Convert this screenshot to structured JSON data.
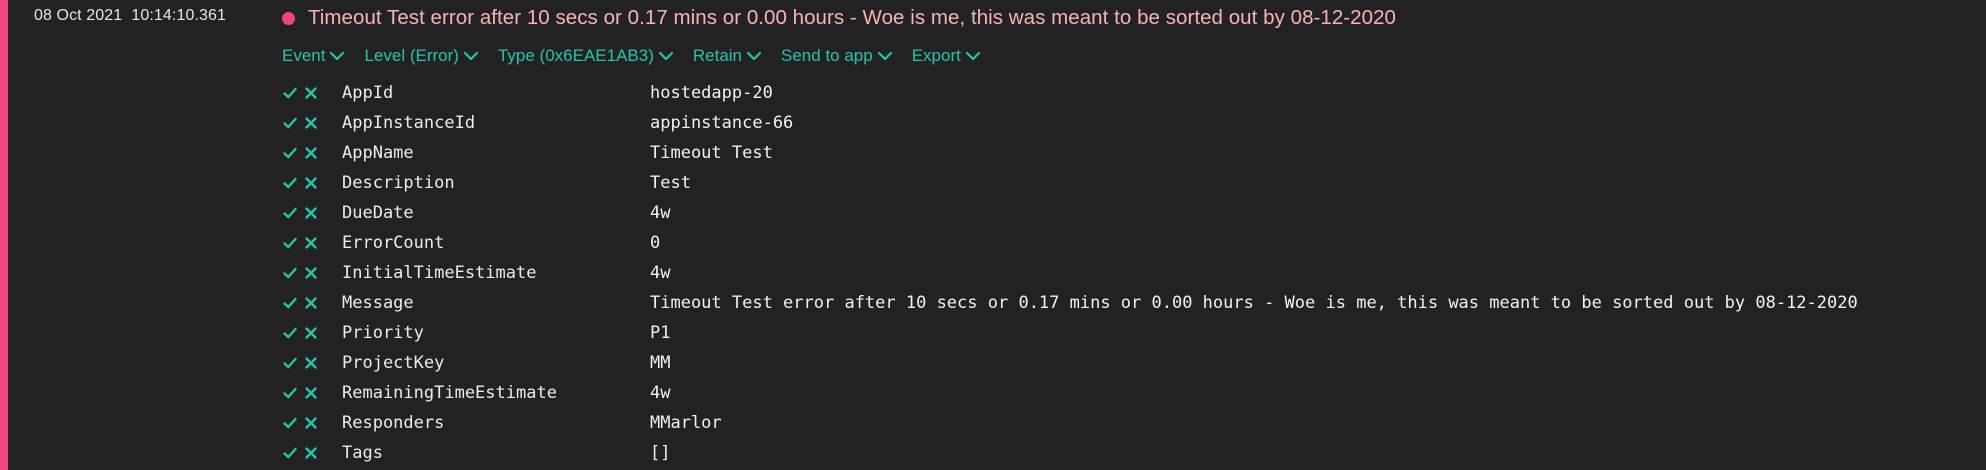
{
  "event": {
    "timestamp": "08 Oct 2021  10:14:10.361",
    "level_color": "#f0457a",
    "title_color": "#f8b4ae",
    "message": "Timeout Test error after 10 secs or 0.17 mins or 0.00 hours - Woe is me, this was meant to be sorted out by 08-12-2020"
  },
  "toolbar": {
    "accent_color": "#27c5a6",
    "items": [
      {
        "label": "Event",
        "icon": "chevron-down-icon"
      },
      {
        "label": "Level (Error)",
        "icon": "chevron-down-icon"
      },
      {
        "label": "Type (0x6EAE1AB3)",
        "icon": "chevron-down-icon"
      },
      {
        "label": "Retain",
        "icon": "chevron-down-icon"
      },
      {
        "label": "Send to app",
        "icon": "chevron-down-icon"
      },
      {
        "label": "Export",
        "icon": "chevron-down-icon"
      }
    ]
  },
  "properties": [
    {
      "name": "AppId",
      "value": "hostedapp-20"
    },
    {
      "name": "AppInstanceId",
      "value": "appinstance-66"
    },
    {
      "name": "AppName",
      "value": "Timeout Test"
    },
    {
      "name": "Description",
      "value": "Test"
    },
    {
      "name": "DueDate",
      "value": "4w"
    },
    {
      "name": "ErrorCount",
      "value": "0"
    },
    {
      "name": "InitialTimeEstimate",
      "value": "4w"
    },
    {
      "name": "Message",
      "value": "Timeout Test error after 10 secs or 0.17 mins or 0.00 hours - Woe is me, this was meant to be sorted out by 08-12-2020"
    },
    {
      "name": "Priority",
      "value": "P1"
    },
    {
      "name": "ProjectKey",
      "value": "MM"
    },
    {
      "name": "RemainingTimeEstimate",
      "value": "4w"
    },
    {
      "name": "Responders",
      "value": "MMarlor"
    },
    {
      "name": "Tags",
      "value": "[]"
    }
  ],
  "property_actions": {
    "include_icon": "check-icon",
    "exclude_icon": "close-icon"
  }
}
